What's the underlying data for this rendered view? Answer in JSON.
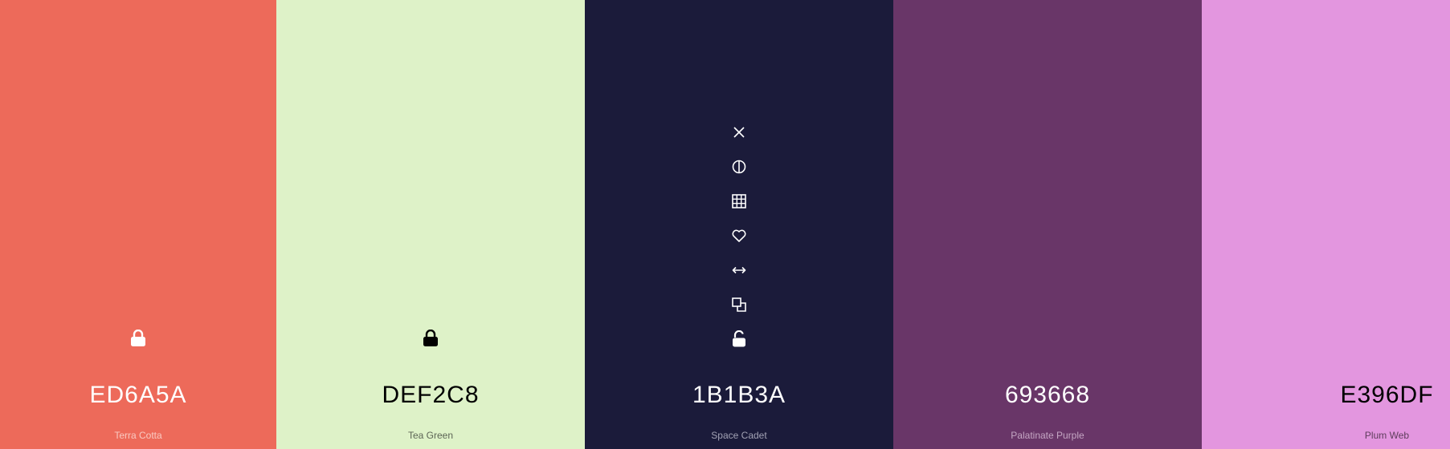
{
  "swatches": [
    {
      "hex": "ED6A5A",
      "name": "Terra Cotta",
      "color": "#ED6A5A",
      "text_color": "#FFFFFF",
      "name_color": "#F9C9C1",
      "locked": true,
      "lock_icon": "lock-icon"
    },
    {
      "hex": "DEF2C8",
      "name": "Tea Green",
      "color": "#DEF2C8",
      "text_color": "#000000",
      "name_color": "#5C6455",
      "locked": true,
      "lock_icon": "lock-icon"
    },
    {
      "hex": "1B1B3A",
      "name": "Space Cadet",
      "color": "#1B1B3A",
      "text_color": "#FFFFFF",
      "name_color": "#A2A2B4",
      "locked": false,
      "lock_icon": "unlock-icon",
      "tools": [
        "close-icon",
        "contrast-icon",
        "grid-icon",
        "heart-icon",
        "arrows-horizontal-icon",
        "copy-icon",
        "unlock-icon"
      ]
    },
    {
      "hex": "693668",
      "name": "Palatinate Purple",
      "color": "#693668",
      "text_color": "#FFFFFF",
      "name_color": "#C4A6C3"
    },
    {
      "hex": "E396DF",
      "name": "Plum Web",
      "color": "#E396DF",
      "text_color": "#000000",
      "name_color": "#5E3D5C"
    }
  ]
}
